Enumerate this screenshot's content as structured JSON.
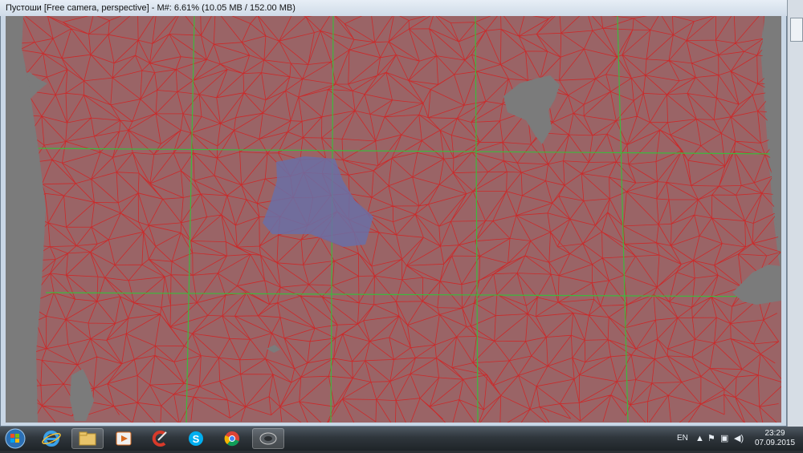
{
  "window": {
    "title": "Пустоши [Free camera, perspective] - M#: 6.61% (10.05 MB / 152.00 MB)"
  },
  "viewport": {
    "description_colors": {
      "mesh_fill": "#9a6466",
      "mesh_edges": "#d42020",
      "chunk_lines": "#3db93d",
      "selected_region": "#6a6fa6",
      "background": "#7b7b7b"
    }
  },
  "taskbar": {
    "apps": [
      {
        "icon": "internet-explorer-icon"
      },
      {
        "icon": "file-explorer-icon"
      },
      {
        "icon": "media-player-icon"
      },
      {
        "icon": "ccleaner-icon"
      },
      {
        "icon": "skype-icon"
      },
      {
        "icon": "chrome-icon"
      },
      {
        "icon": "editor-app-icon"
      }
    ],
    "tray": {
      "language": "EN",
      "icons": [
        "show-hidden-icons-icon",
        "action-center-flag-icon",
        "network-icon",
        "volume-icon"
      ],
      "time": "23:29",
      "date": "07.09.2015"
    }
  }
}
